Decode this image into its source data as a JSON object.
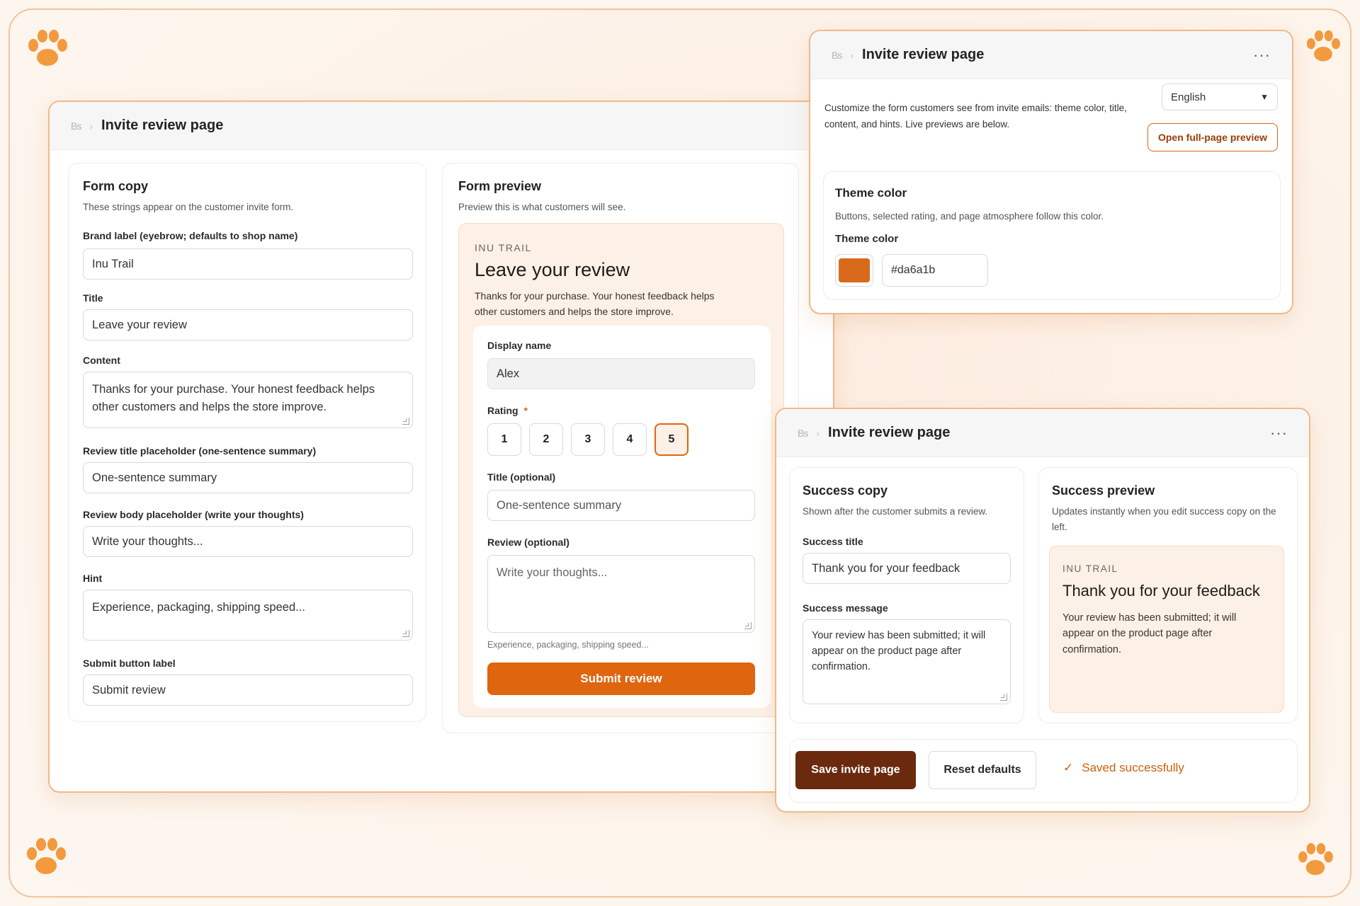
{
  "colors": {
    "accent": "#e0650f",
    "accent_dark": "#6b2a0e",
    "border": "#f0b98a",
    "theme": "#da6a1b"
  },
  "windows": {
    "main": {
      "breadcrumb_icon": "Bs",
      "title": "Invite review page",
      "form_copy": {
        "title": "Form copy",
        "subtitle": "These strings appear on the customer invite form.",
        "brand_label": "Brand label (eyebrow; defaults to shop name)",
        "brand_value": "Inu Trail",
        "title_label": "Title",
        "title_value": "Leave your review",
        "content_label": "Content",
        "content_value": "Thanks for your purchase. Your honest feedback helps other customers and helps the store improve.",
        "review_title_label": "Review title placeholder (one-sentence summary)",
        "review_title_value": "One-sentence summary",
        "review_body_label": "Review body placeholder (write your thoughts)",
        "review_body_value": "Write your thoughts...",
        "hint_label": "Hint",
        "hint_value": "Experience, packaging, shipping speed...",
        "submit_label": "Submit button label",
        "submit_value": "Submit review"
      },
      "form_preview": {
        "title": "Form preview",
        "subtitle": "Preview this is what customers will see.",
        "eyebrow": "INU TRAIL",
        "heading": "Leave your review",
        "body": "Thanks for your purchase. Your honest feedback helps other customers and helps the store improve.",
        "display_name_label": "Display name",
        "display_name_value": "Alex",
        "rating_label": "Rating",
        "required_mark": "*",
        "ratings": [
          "1",
          "2",
          "3",
          "4",
          "5"
        ],
        "selected_rating": 5,
        "title_optional_label": "Title (optional)",
        "title_placeholder": "One-sentence summary",
        "review_optional_label": "Review (optional)",
        "review_placeholder": "Write your thoughts...",
        "hint": "Experience, packaging, shipping speed...",
        "submit": "Submit review"
      }
    },
    "theme": {
      "breadcrumb_icon": "Bs",
      "title": "Invite review page",
      "more": "···",
      "description": "Customize the form customers see from invite emails: theme color, title, content, and hints. Live previews are below.",
      "language": "English",
      "open_preview": "Open full-page preview",
      "card_title": "Theme color",
      "card_sub": "Buttons, selected rating, and page atmosphere follow this color.",
      "field_label": "Theme color",
      "hex_value": "#da6a1b"
    },
    "success": {
      "breadcrumb_icon": "Bs",
      "title": "Invite review page",
      "more": "···",
      "copy_title": "Success copy",
      "copy_sub": "Shown after the customer submits a review.",
      "success_title_label": "Success title",
      "success_title_value": "Thank you for your feedback",
      "success_message_label": "Success message",
      "success_message_value": "Your review has been submitted; it will appear on the product page after confirmation.",
      "preview_title": "Success preview",
      "preview_sub": "Updates instantly when you edit success copy on the left.",
      "preview_eyebrow": "INU TRAIL",
      "preview_heading": "Thank you for your feedback",
      "preview_body": "Your review has been submitted; it will appear on the product page after confirmation.",
      "save": "Save invite page",
      "reset": "Reset defaults",
      "saved_check": "✓",
      "saved_text": "Saved successfully"
    }
  }
}
